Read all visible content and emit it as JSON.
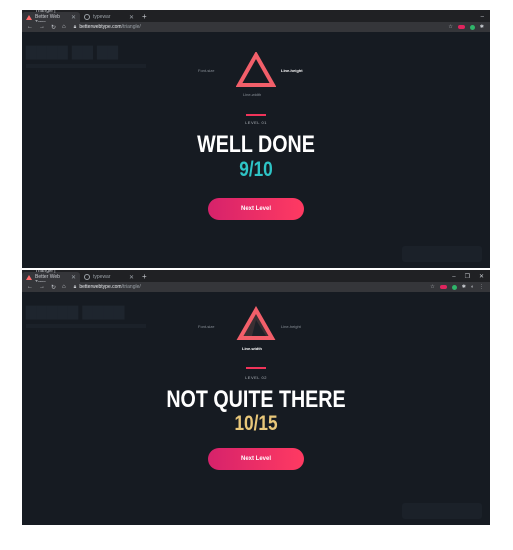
{
  "screens": [
    {
      "tabs": [
        {
          "title": "Triangle | Better Web Type"
        },
        {
          "title": "typewar"
        }
      ],
      "url": {
        "host": "betterwebtype.com",
        "path": "/triangle/"
      },
      "labels": {
        "font_size": "Font-size",
        "line_height": "Line-height",
        "line_width": "Line-width"
      },
      "highlight": "line_height",
      "level": "LEVEL 01",
      "headline": "WELL DONE",
      "score": "9/10",
      "score_color": "#2ec4c6",
      "button": "Next Level"
    },
    {
      "tabs": [
        {
          "title": "Triangle | Better Web Type"
        },
        {
          "title": "typewar"
        }
      ],
      "url": {
        "host": "betterwebtype.com",
        "path": "/triangle/"
      },
      "labels": {
        "font_size": "Font-size",
        "line_height": "Line-height",
        "line_width": "Line-width"
      },
      "highlight": "line_width",
      "level": "LEVEL 02",
      "headline": "NOT QUITE THERE",
      "score": "10/15",
      "score_color": "#e8c77a",
      "button": "Next Level"
    }
  ],
  "colors": {
    "triangle": "#f25f6a",
    "accent": "#f0345a",
    "background": "#161b22"
  }
}
